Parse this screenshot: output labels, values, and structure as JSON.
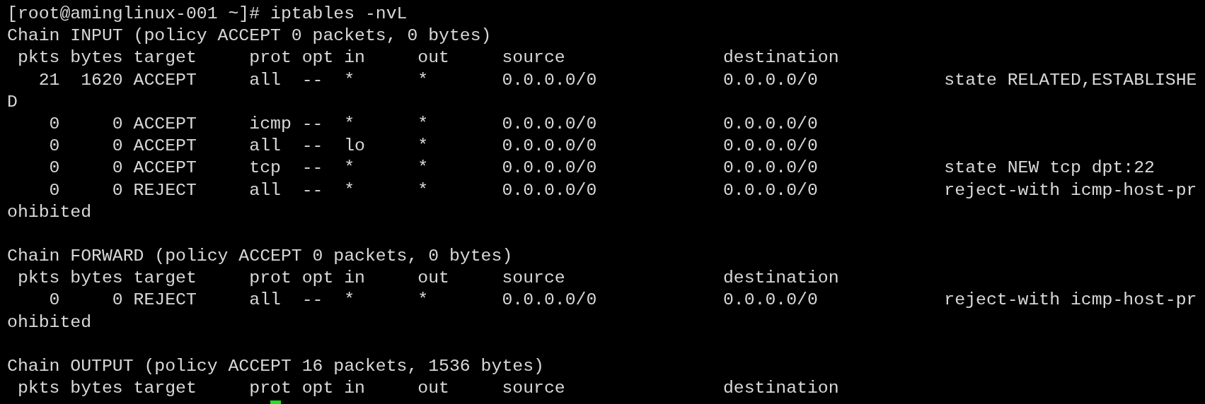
{
  "terminal": {
    "lines": [
      {
        "kind": "text",
        "text": "[root@aminglinux-001 ~]# iptables -nvL"
      },
      {
        "kind": "text",
        "text": "Chain INPUT (policy ACCEPT 0 packets, 0 bytes)"
      },
      {
        "kind": "text",
        "text": " pkts bytes target     prot opt in     out     source               destination"
      },
      {
        "kind": "text",
        "text": "   21  1620 ACCEPT     all  --  *      *       0.0.0.0/0            0.0.0.0/0            state RELATED,ESTABLISHE"
      },
      {
        "kind": "text",
        "text": "D"
      },
      {
        "kind": "text",
        "text": "    0     0 ACCEPT     icmp --  *      *       0.0.0.0/0            0.0.0.0/0"
      },
      {
        "kind": "text",
        "text": "    0     0 ACCEPT     all  --  lo     *       0.0.0.0/0            0.0.0.0/0"
      },
      {
        "kind": "text",
        "text": "    0     0 ACCEPT     tcp  --  *      *       0.0.0.0/0            0.0.0.0/0            state NEW tcp dpt:22"
      },
      {
        "kind": "text",
        "text": "    0     0 REJECT     all  --  *      *       0.0.0.0/0            0.0.0.0/0            reject-with icmp-host-pr"
      },
      {
        "kind": "text",
        "text": "ohibited"
      },
      {
        "kind": "blank"
      },
      {
        "kind": "text",
        "text": "Chain FORWARD (policy ACCEPT 0 packets, 0 bytes)"
      },
      {
        "kind": "text",
        "text": " pkts bytes target     prot opt in     out     source               destination"
      },
      {
        "kind": "text",
        "text": "    0     0 REJECT     all  --  *      *       0.0.0.0/0            0.0.0.0/0            reject-with icmp-host-pr"
      },
      {
        "kind": "text",
        "text": "ohibited"
      },
      {
        "kind": "blank"
      },
      {
        "kind": "text",
        "text": "Chain OUTPUT (policy ACCEPT 16 packets, 1536 bytes)"
      },
      {
        "kind": "text",
        "text": " pkts bytes target     prot opt in     out     source               destination"
      },
      {
        "kind": "prompt",
        "cursor": true
      }
    ]
  }
}
